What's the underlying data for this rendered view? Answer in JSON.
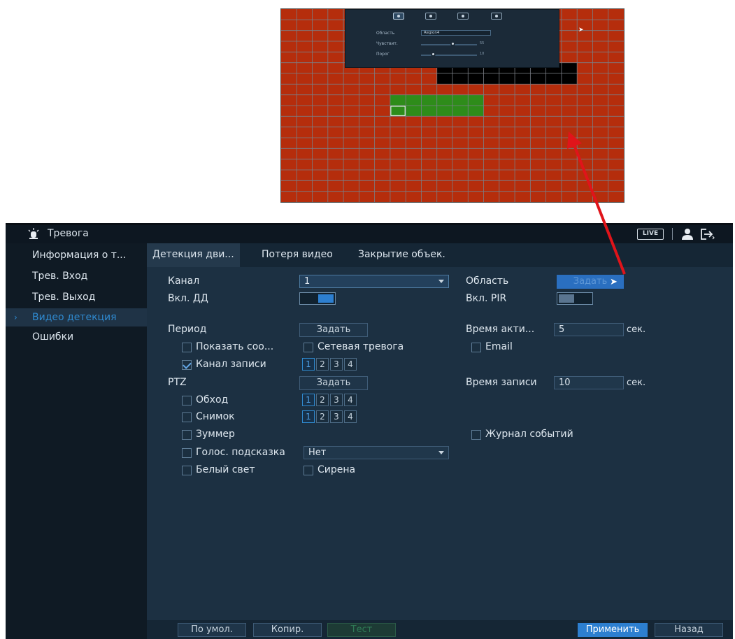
{
  "region_panel": {
    "rows": [
      {
        "label": "Область",
        "value": "Region4"
      },
      {
        "label": "Чувствит.",
        "value": "55"
      },
      {
        "label": "Порог",
        "value": "10"
      }
    ]
  },
  "topbar": {
    "title": "Тревога",
    "live_label": "LIVE"
  },
  "sidebar": {
    "items": [
      {
        "label": "Информация о т..."
      },
      {
        "label": "Трев. Вход"
      },
      {
        "label": "Трев. Выход"
      },
      {
        "label": "Видео детекция",
        "active": true
      },
      {
        "label": "Ошибки"
      }
    ]
  },
  "tabs": [
    {
      "label": "Детекция дви..."
    },
    {
      "label": "Потеря видео"
    },
    {
      "label": "Закрытие объек."
    }
  ],
  "form": {
    "channel_label": "Канал",
    "channel_value": "1",
    "md_enable_label": "Вкл. ДД",
    "md_enable_on": true,
    "area_label": "Область",
    "area_button": "Задать",
    "pir_label": "Вкл. PIR",
    "pir_on": false,
    "period_label": "Период",
    "period_button": "Задать",
    "anti_dither_label": "Время акти...",
    "anti_dither_value": "5",
    "anti_dither_unit": "сек.",
    "show_msg_label": "Показать соо...",
    "show_msg_checked": false,
    "net_alarm_label": "Сетевая тревога",
    "net_alarm_checked": false,
    "email_label": "Email",
    "email_checked": false,
    "record_channel_label": "Канал записи",
    "record_channel_checked": true,
    "record_channels": [
      "1",
      "2",
      "3",
      "4"
    ],
    "ptz_label": "PTZ",
    "ptz_button": "Задать",
    "post_record_label": "Время записи",
    "post_record_value": "10",
    "post_record_unit": "сек.",
    "tour_label": "Обход",
    "tour_checked": false,
    "tour_channels": [
      "1",
      "2",
      "3",
      "4"
    ],
    "snapshot_label": "Снимок",
    "snapshot_checked": false,
    "snapshot_channels": [
      "1",
      "2",
      "3",
      "4"
    ],
    "buzzer_label": "Зуммер",
    "buzzer_checked": false,
    "log_label": "Журнал событий",
    "log_checked": false,
    "voice_label": "Голос. подсказка",
    "voice_checked": false,
    "voice_value": "Нет",
    "white_light_label": "Белый свет",
    "white_light_checked": false,
    "siren_label": "Сирена",
    "siren_checked": false
  },
  "bottom": {
    "default_button": "По умол.",
    "copy_button": "Копир.",
    "test_button": "Тест",
    "apply_button": "Применить",
    "back_button": "Назад"
  },
  "colors": {
    "region_red": "#b52d0c",
    "region_green": "#2e8c1a",
    "region_black": "#000000",
    "accent_blue": "#2d7fd0",
    "arrow_red": "#e0141a"
  }
}
